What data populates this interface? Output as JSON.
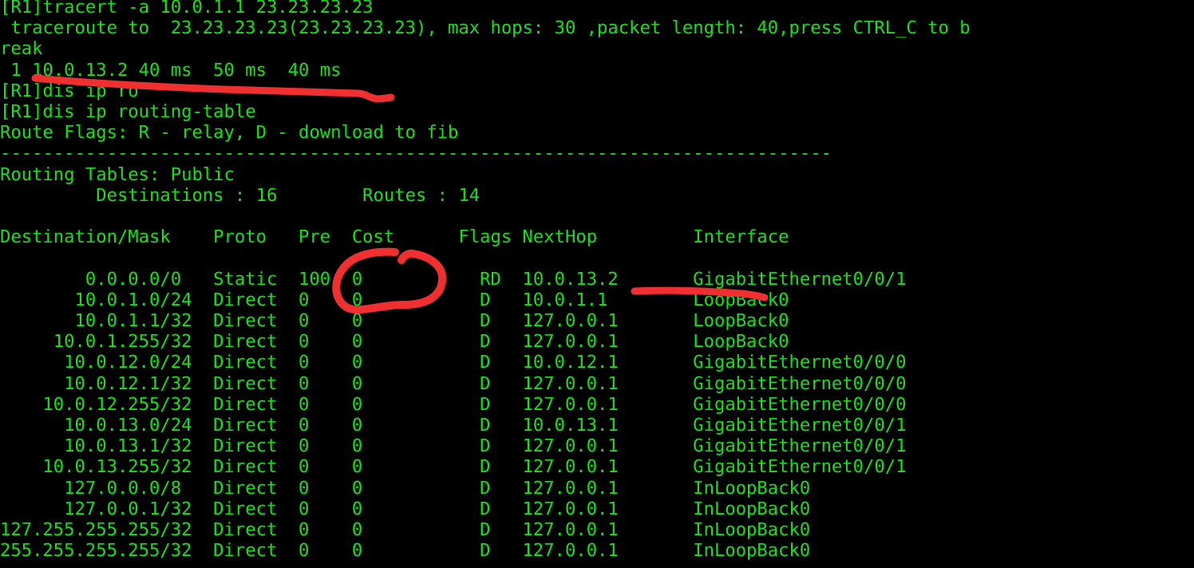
{
  "terminal": {
    "prompt": "[R1]",
    "background_color": "#000000",
    "text_color": "#13e413",
    "annotation_color": "#f03030",
    "lines": [
      "[R1]tracert -a 10.0.1.1 23.23.23.23",
      " traceroute to  23.23.23.23(23.23.23.23), max hops: 30 ,packet length: 40,press CTRL_C to b",
      "reak",
      " 1 10.0.13.2 40 ms  50 ms  40 ms",
      "[R1]dis ip ro",
      "[R1]dis ip routing-table",
      "Route Flags: R - relay, D - download to fib",
      "------------------------------------------------------------------------------",
      "Routing Tables: Public",
      "         Destinations : 16        Routes : 14",
      "",
      "Destination/Mask    Proto   Pre  Cost      Flags NextHop         Interface",
      "",
      "        0.0.0.0/0   Static  100  0           RD  10.0.13.2       GigabitEthernet0/0/1",
      "       10.0.1.0/24  Direct  0    0           D   10.0.1.1        LoopBack0",
      "       10.0.1.1/32  Direct  0    0           D   127.0.0.1       LoopBack0",
      "     10.0.1.255/32  Direct  0    0           D   127.0.0.1       LoopBack0",
      "      10.0.12.0/24  Direct  0    0           D   10.0.12.1       GigabitEthernet0/0/0",
      "      10.0.12.1/32  Direct  0    0           D   127.0.0.1       GigabitEthernet0/0/0",
      "    10.0.12.255/32  Direct  0    0           D   127.0.0.1       GigabitEthernet0/0/0",
      "      10.0.13.0/24  Direct  0    0           D   10.0.13.1       GigabitEthernet0/0/1",
      "      10.0.13.1/32  Direct  0    0           D   127.0.0.1       GigabitEthernet0/0/1",
      "    10.0.13.255/32  Direct  0    0           D   127.0.0.1       GigabitEthernet0/0/1",
      "      127.0.0.0/8   Direct  0    0           D   127.0.0.1       InLoopBack0",
      "      127.0.0.1/32  Direct  0    0           D   127.0.0.1       InLoopBack0",
      "127.255.255.255/32  Direct  0    0           D   127.0.0.1       InLoopBack0",
      "255.255.255.255/32  Direct  0    0           D   127.0.0.1       InLoopBack0"
    ],
    "commands": [
      {
        "prompt": "[R1]",
        "text": "tracert -a 10.0.1.1 23.23.23.23"
      },
      {
        "prompt": "[R1]",
        "text": "dis ip ro"
      },
      {
        "prompt": "[R1]",
        "text": "dis ip routing-table"
      }
    ],
    "traceroute": {
      "header": "traceroute to  23.23.23.23(23.23.23.23), max hops: 30 ,packet length: 40,press CTRL_C to break",
      "destination": "23.23.23.23",
      "resolved": "23.23.23.23",
      "max_hops": "30",
      "packet_length": "40",
      "break_key": "CTRL_C",
      "hops": [
        {
          "hop": "1",
          "address": "10.0.13.2",
          "rtt1": "40 ms",
          "rtt2": "50 ms",
          "rtt3": "40 ms"
        }
      ]
    },
    "routing": {
      "route_flags": "Route Flags: R - relay, D - download to fib",
      "separator": "------------------------------------------------------------------------------",
      "table_title": "Routing Tables: Public",
      "destinations_label": "Destinations :",
      "destinations_value": "16",
      "routes_label": "Routes :",
      "routes_value": "14",
      "columns": [
        "Destination/Mask",
        "Proto",
        "Pre",
        "Cost",
        "Flags",
        "NextHop",
        "Interface"
      ],
      "rows": [
        {
          "dest": "0.0.0.0/0",
          "proto": "Static",
          "pre": "100",
          "cost": "0",
          "flags": "RD",
          "nexthop": "10.0.13.2",
          "interface": "GigabitEthernet0/0/1"
        },
        {
          "dest": "10.0.1.0/24",
          "proto": "Direct",
          "pre": "0",
          "cost": "0",
          "flags": "D",
          "nexthop": "10.0.1.1",
          "interface": "LoopBack0"
        },
        {
          "dest": "10.0.1.1/32",
          "proto": "Direct",
          "pre": "0",
          "cost": "0",
          "flags": "D",
          "nexthop": "127.0.0.1",
          "interface": "LoopBack0"
        },
        {
          "dest": "10.0.1.255/32",
          "proto": "Direct",
          "pre": "0",
          "cost": "0",
          "flags": "D",
          "nexthop": "127.0.0.1",
          "interface": "LoopBack0"
        },
        {
          "dest": "10.0.12.0/24",
          "proto": "Direct",
          "pre": "0",
          "cost": "0",
          "flags": "D",
          "nexthop": "10.0.12.1",
          "interface": "GigabitEthernet0/0/0"
        },
        {
          "dest": "10.0.12.1/32",
          "proto": "Direct",
          "pre": "0",
          "cost": "0",
          "flags": "D",
          "nexthop": "127.0.0.1",
          "interface": "GigabitEthernet0/0/0"
        },
        {
          "dest": "10.0.12.255/32",
          "proto": "Direct",
          "pre": "0",
          "cost": "0",
          "flags": "D",
          "nexthop": "127.0.0.1",
          "interface": "GigabitEthernet0/0/0"
        },
        {
          "dest": "10.0.13.0/24",
          "proto": "Direct",
          "pre": "0",
          "cost": "0",
          "flags": "D",
          "nexthop": "10.0.13.1",
          "interface": "GigabitEthernet0/0/1"
        },
        {
          "dest": "10.0.13.1/32",
          "proto": "Direct",
          "pre": "0",
          "cost": "0",
          "flags": "D",
          "nexthop": "127.0.0.1",
          "interface": "GigabitEthernet0/0/1"
        },
        {
          "dest": "10.0.13.255/32",
          "proto": "Direct",
          "pre": "0",
          "cost": "0",
          "flags": "D",
          "nexthop": "127.0.0.1",
          "interface": "GigabitEthernet0/0/1"
        },
        {
          "dest": "127.0.0.0/8",
          "proto": "Direct",
          "pre": "0",
          "cost": "0",
          "flags": "D",
          "nexthop": "127.0.0.1",
          "interface": "InLoopBack0"
        },
        {
          "dest": "127.0.0.1/32",
          "proto": "Direct",
          "pre": "0",
          "cost": "0",
          "flags": "D",
          "nexthop": "127.0.0.1",
          "interface": "InLoopBack0"
        },
        {
          "dest": "127.255.255.255/32",
          "proto": "Direct",
          "pre": "0",
          "cost": "0",
          "flags": "D",
          "nexthop": "127.0.0.1",
          "interface": "InLoopBack0"
        },
        {
          "dest": "255.255.255.255/32",
          "proto": "Direct",
          "pre": "0",
          "cost": "0",
          "flags": "D",
          "nexthop": "127.0.0.1",
          "interface": "InLoopBack0"
        }
      ]
    }
  },
  "annotations": {
    "color": "#f03030",
    "marks": [
      {
        "name": "underline-traceroute-hop",
        "type": "underline",
        "target": " 1 10.0.13.2 40 ms  50 ms  40 ms"
      },
      {
        "name": "circle-preference-100",
        "type": "ellipse",
        "target": "100"
      },
      {
        "name": "underline-nexthop",
        "type": "underline",
        "target": "10.0.13.2"
      }
    ]
  }
}
